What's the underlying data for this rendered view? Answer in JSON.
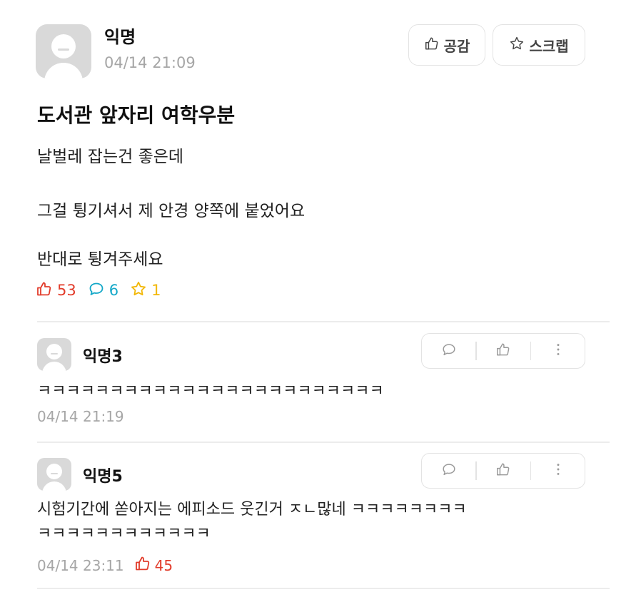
{
  "post": {
    "author": "익명",
    "time": "04/14 21:09",
    "like_button_label": "공감",
    "scrap_button_label": "스크랩",
    "title": "도서관 앞자리 여학우분",
    "body_lines": [
      "날벌레 잡는건 좋은데",
      "그걸 튕기셔서 제 안경 양쪽에 붙었어요",
      "반대로 튕겨주세요"
    ],
    "stats": {
      "likes": "53",
      "comments": "6",
      "scraps": "1"
    }
  },
  "comments": [
    {
      "author": "익명3",
      "text_lines": [
        "ㅋㅋㅋㅋㅋㅋㅋㅋㅋㅋㅋㅋㅋㅋㅋㅋㅋㅋㅋㅋㅋㅋㅋㅋ"
      ],
      "time": "04/14 21:19",
      "likes": ""
    },
    {
      "author": "익명5",
      "text_lines": [
        "시험기간에 쏟아지는 에피소드 웃긴거 ㅈㄴ많네 ㅋㅋㅋㅋㅋㅋㅋㅋ",
        "ㅋㅋㅋㅋㅋㅋㅋㅋㅋㅋㅋㅋ"
      ],
      "time": "04/14 23:11",
      "likes": "45"
    }
  ],
  "colors": {
    "like": "#e23c2b",
    "comment": "#14a8c8",
    "scrap": "#f2b705",
    "meta_gray": "#a6a6a6",
    "border": "#e3e3e3"
  },
  "icons": {
    "like": "thumbs-up-icon",
    "comment": "speech-bubble-icon",
    "scrap": "star-icon",
    "more": "vertical-dots-icon",
    "avatar": "default-user-avatar-icon"
  }
}
